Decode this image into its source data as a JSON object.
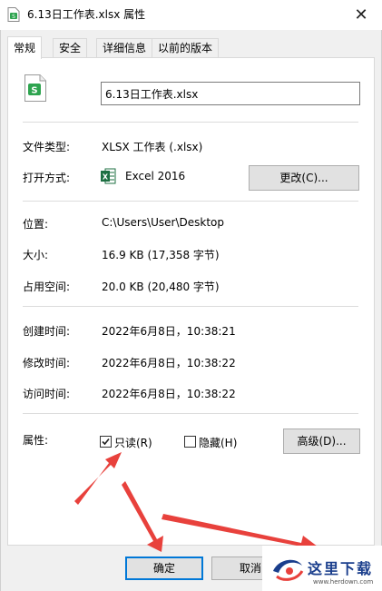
{
  "window": {
    "title": "6.13日工作表.xlsx 属性",
    "close_icon": "close-icon"
  },
  "tabs": [
    {
      "label": "常规",
      "active": true
    },
    {
      "label": "安全",
      "active": false
    },
    {
      "label": "详细信息",
      "active": false
    },
    {
      "label": "以前的版本",
      "active": false
    }
  ],
  "general": {
    "file_name": "6.13日工作表.xlsx",
    "file_type_label": "文件类型:",
    "file_type_value": "XLSX 工作表 (.xlsx)",
    "open_with_label": "打开方式:",
    "open_with_value": "Excel 2016",
    "change_button": "更改(C)...",
    "location_label": "位置:",
    "location_value": "C:\\Users\\User\\Desktop",
    "size_label": "大小:",
    "size_value": "16.9 KB (17,358 字节)",
    "disk_size_label": "占用空间:",
    "disk_size_value": "20.0 KB (20,480 字节)",
    "created_label": "创建时间:",
    "created_value": "2022年6月8日，10:38:21",
    "modified_label": "修改时间:",
    "modified_value": "2022年6月8日，10:38:22",
    "accessed_label": "访问时间:",
    "accessed_value": "2022年6月8日，10:38:22",
    "attributes_label": "属性:",
    "readonly_label": "只读(R)",
    "readonly_checked": true,
    "hidden_label": "隐藏(H)",
    "hidden_checked": false,
    "advanced_button": "高级(D)..."
  },
  "footer": {
    "ok_button": "确定",
    "cancel_button": "取消"
  },
  "watermark": {
    "name": "这里下载",
    "url": "www.herdown.com"
  },
  "colors": {
    "excel_green": "#1d6f42",
    "annotation_red": "#e8413c",
    "accent_blue": "#0078d7"
  }
}
